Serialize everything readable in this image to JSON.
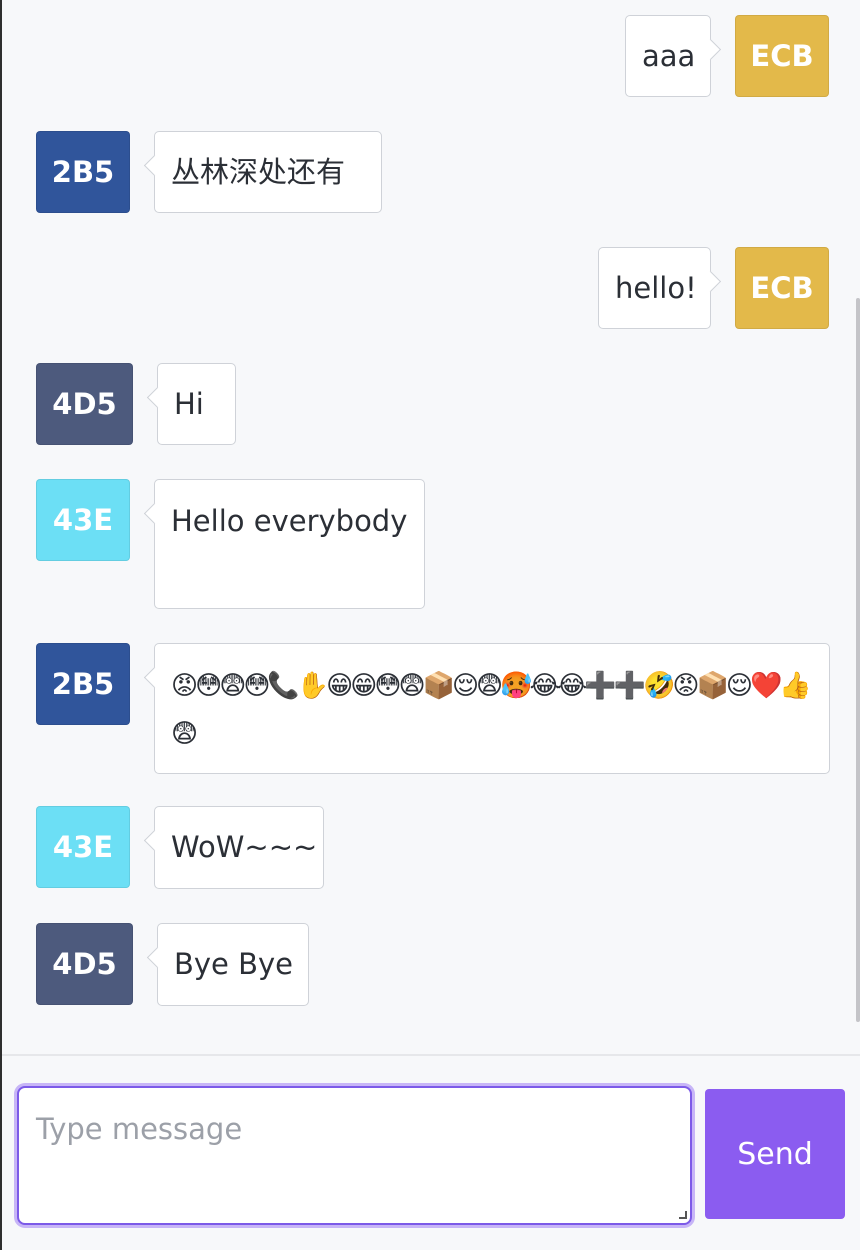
{
  "colors": {
    "ECB": "#e3b94a",
    "2B5": "#30559b",
    "4D5": "#4d5a7d",
    "43E": "#6cdff5",
    "accent": "#8b5cf0"
  },
  "messages": [
    {
      "sender": "ECB",
      "text": "aaa"
    },
    {
      "sender": "2B5",
      "text": "丛林深处还有"
    },
    {
      "sender": "ECB",
      "text": "hello!"
    },
    {
      "sender": "4D5",
      "text": "Hi"
    },
    {
      "sender": "43E",
      "text": "Hello everybody"
    },
    {
      "sender": "2B5",
      "text": "😡😳😨😳📞✋😁😁😳😨📦😌😨🥵😂😂➕➕🤣😡📦😌❤️👍😨"
    },
    {
      "sender": "43E",
      "text": "WoW~~~"
    },
    {
      "sender": "4D5",
      "text": "Bye Bye"
    }
  ],
  "composer": {
    "placeholder": "Type message",
    "send_label": "Send"
  }
}
